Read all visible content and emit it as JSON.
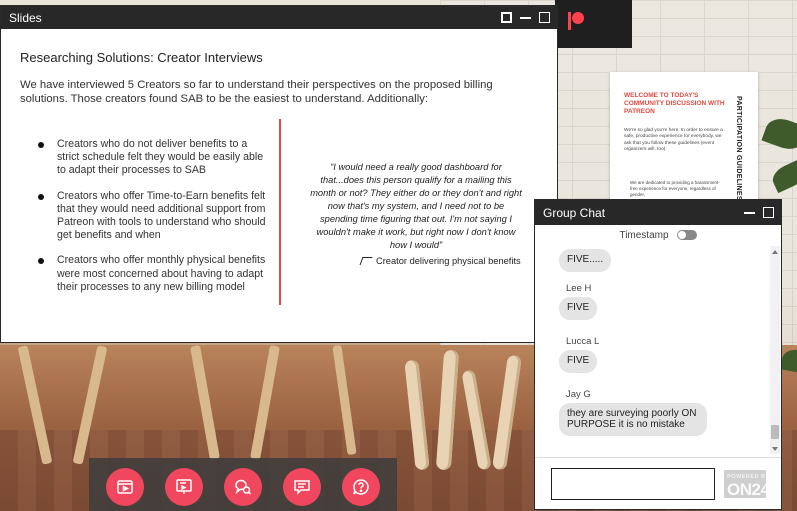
{
  "slides": {
    "title": "Slides",
    "heading": "Researching Solutions: Creator Interviews",
    "intro": "We have interviewed 5 Creators so far to understand their perspectives on the proposed billing solutions. Those creators found SAB to be the easiest to understand. Additionally:",
    "bullets": [
      "Creators who do not deliver benefits to a strict schedule felt they would be easily able to adapt their processes to SAB",
      "Creators who offer Time-to-Earn benefits felt that they would need additional support from Patreon with tools to understand who should get benefits and when",
      "Creators who offer monthly physical benefits were most concerned about having to adapt their processes to any new billing model"
    ],
    "quote": "“I would need a really good dashboard for that...does this person qualify for a mailing this month or not? They either do or they don't and right now that's my system, and I need not to be spending time figuring that out. I'm not saying I wouldn't make it work, but right now I don't know how I would”",
    "quote_attribution": "Creator delivering physical benefits"
  },
  "poster": {
    "title": "WELCOME TO TODAY'S COMMUNITY DISCUSSION WITH PATREON",
    "body": "We're so glad you're here. In order to ensure a safe, productive experience for everybody, we ask that you follow these guidelines (event organizers will, too):",
    "bullet": "We are dedicated to providing a harassment-free experience for everyone, regardless of gender,",
    "side_title": "PARTICIPATION GUIDELINES"
  },
  "chat": {
    "title": "Group Chat",
    "timestamp_label": "Timestamp",
    "timestamp_on": false,
    "messages": [
      {
        "name": "",
        "text": "FIVE....."
      },
      {
        "name": "Lee H",
        "text": "FIVE"
      },
      {
        "name": "Lucca L",
        "text": "FIVE"
      },
      {
        "name": "Jay G",
        "text": "they are surveying poorly ON PURPOSE it is no mistake"
      }
    ],
    "input_value": "",
    "send_label": ""
  },
  "branding": {
    "powered_by": "POWERED BY",
    "logo": "ON24"
  },
  "toolbar": {
    "buttons": [
      {
        "icon": "media-player-icon",
        "label": "Media Player"
      },
      {
        "icon": "slides-icon",
        "label": "Slides"
      },
      {
        "icon": "qa-icon",
        "label": "Q&A"
      },
      {
        "icon": "chat-icon",
        "label": "Group Chat"
      },
      {
        "icon": "help-icon",
        "label": "Help"
      }
    ]
  },
  "colors": {
    "accent": "#f0475e",
    "header_bg": "#282828",
    "divider": "#e0493e",
    "brand_red": "#ff424d"
  }
}
